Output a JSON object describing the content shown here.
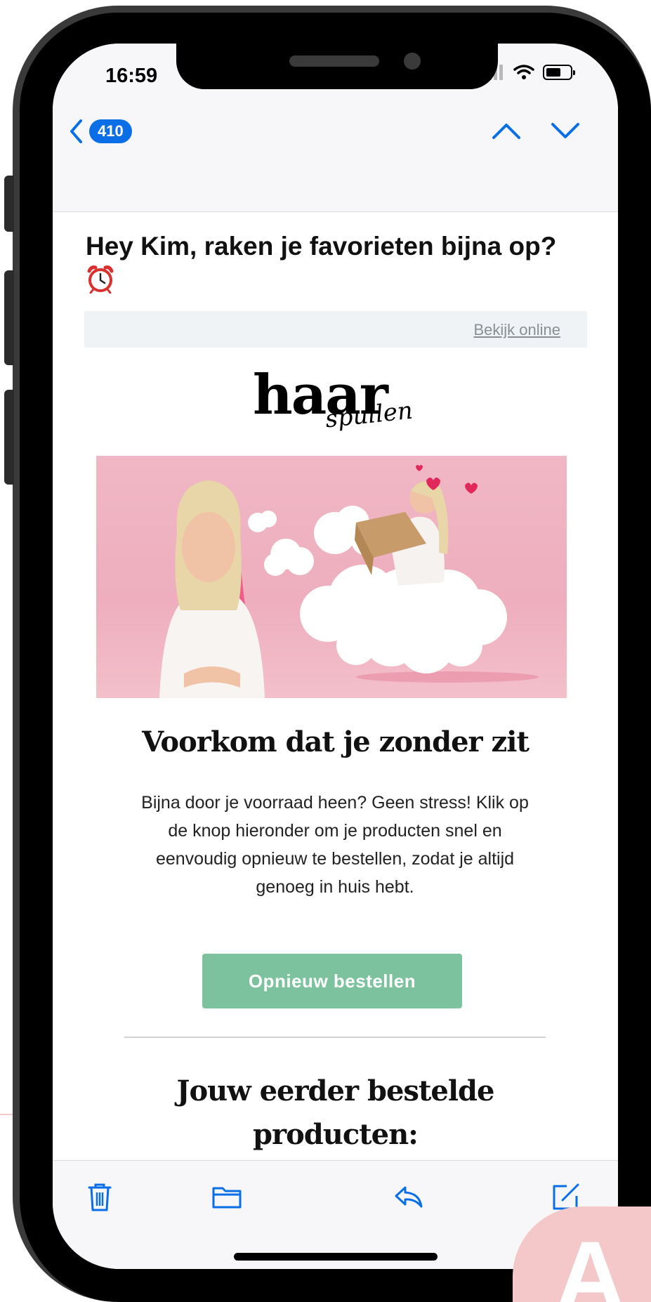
{
  "status": {
    "time": "16:59"
  },
  "nav": {
    "unread_count": "410"
  },
  "email": {
    "subject": "Hey Kim, raken je favorieten bijna op?",
    "view_online": "Bekijk online",
    "logo_main": "haar",
    "logo_script": "spullen",
    "heading": "Voorkom dat je zonder zit",
    "body": "Bijna door je voorraad heen? Geen stress! Klik op de knop hieronder om je producten snel en eenvoudig opnieuw te bestellen, zodat je altijd genoeg in huis hebt.",
    "cta_label": "Opnieuw bestellen",
    "section_heading": "Jouw eerder bestelde producten:"
  },
  "toolbar": {
    "icons": [
      "trash-icon",
      "folder-icon",
      "reply-icon",
      "compose-icon"
    ]
  },
  "watermark": {
    "letter": "A"
  },
  "colors": {
    "accent": "#0a6ee6",
    "cta": "#7cc29e",
    "hero_pink": "#eeaebd",
    "watermark": "#f4c7c8"
  }
}
